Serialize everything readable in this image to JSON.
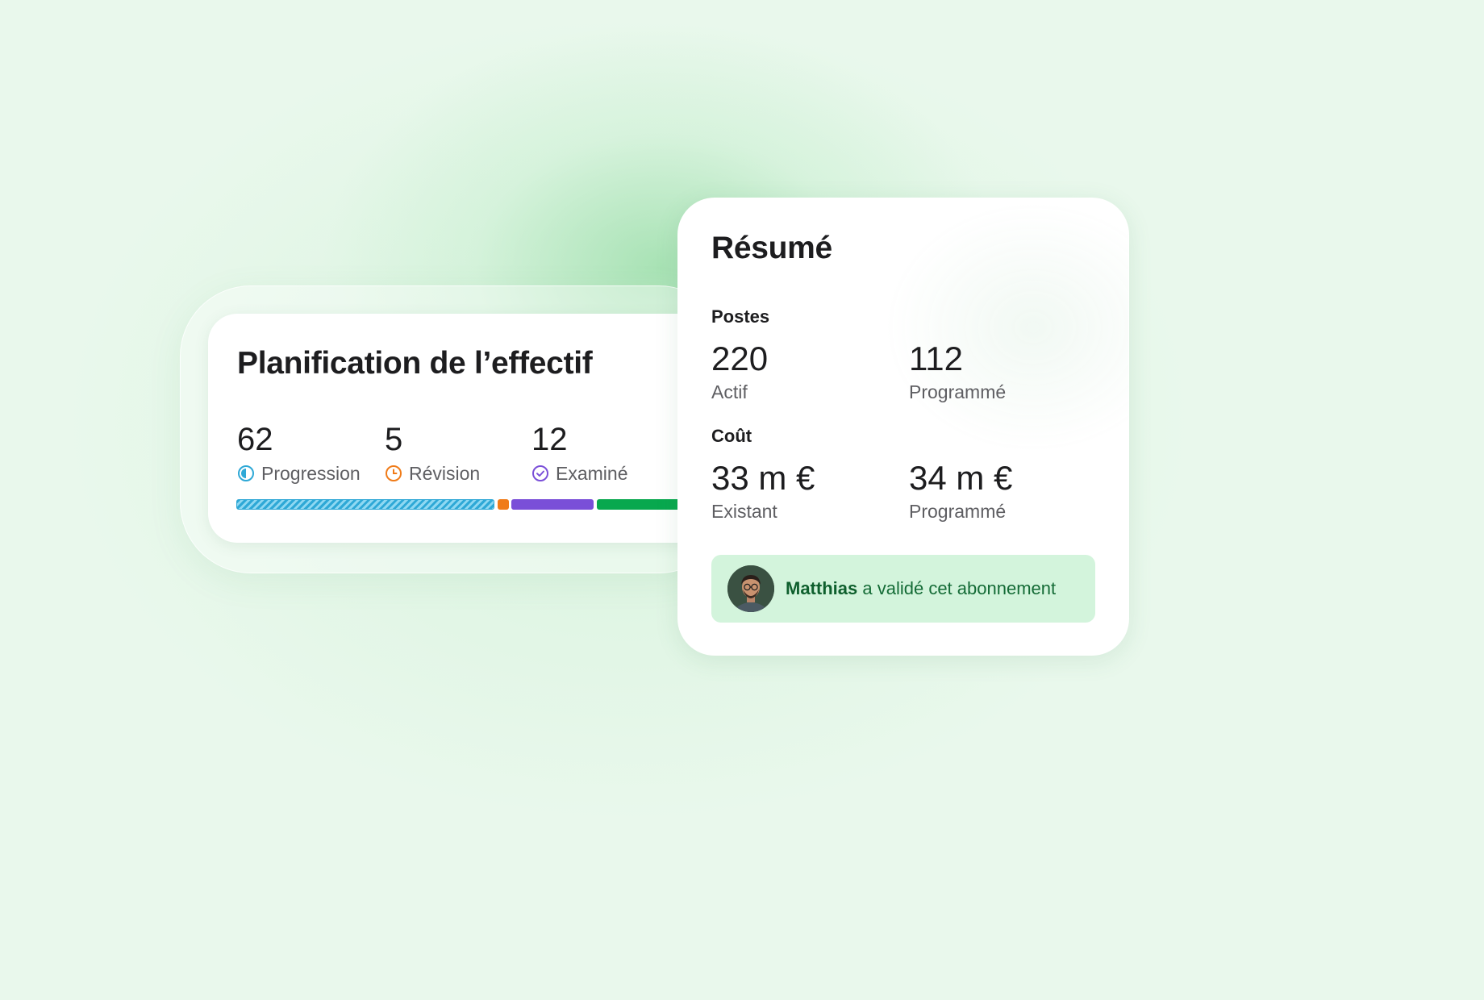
{
  "workforce": {
    "title": "Planification de l’effectif",
    "stats": [
      {
        "value": "62",
        "label": "Progression",
        "icon": "half-circle-icon",
        "color": "#2ea8d6"
      },
      {
        "value": "5",
        "label": "Révision",
        "icon": "clock-icon",
        "color": "#f07b18"
      },
      {
        "value": "12",
        "label": "Examiné",
        "icon": "check-circle-icon",
        "color": "#7a4fd8"
      }
    ]
  },
  "summary": {
    "title": "Résumé",
    "positions": {
      "label": "Postes",
      "active_value": "220",
      "active_label": "Actif",
      "scheduled_value": "112",
      "scheduled_label": "Programmé"
    },
    "cost": {
      "label": "Coût",
      "existing_value": "33 m €",
      "existing_label": "Existant",
      "scheduled_value": "34 m €",
      "scheduled_label": "Programmé"
    },
    "approval": {
      "name": "Matthias",
      "text": "a validé cet abonnement",
      "avatar_icon": "user-avatar"
    }
  },
  "colors": {
    "background": "#e9f8ec",
    "progress": "#2ea8d6",
    "revision": "#f07b18",
    "examined": "#7a4fd8",
    "done": "#08a84e",
    "approval_bg": "#d3f4dc",
    "approval_text": "#146b36"
  }
}
